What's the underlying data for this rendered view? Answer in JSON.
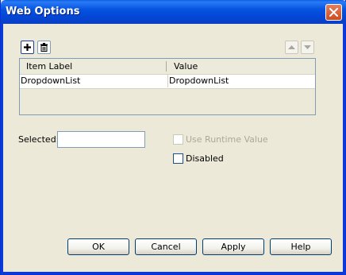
{
  "window": {
    "title": "Web Options"
  },
  "toolbar": {
    "add_icon": "plus-icon",
    "delete_icon": "trash-icon",
    "move_up_icon": "triangle-up-icon",
    "move_down_icon": "triangle-down-icon"
  },
  "grid": {
    "columns": [
      "Item Label",
      "Value"
    ],
    "rows": [
      {
        "label": "DropdownList",
        "value": "DropdownList"
      }
    ]
  },
  "selected": {
    "label": "Selected:",
    "value": ""
  },
  "use_runtime_value": {
    "label": "Use Runtime Value",
    "checked": false,
    "enabled": false
  },
  "disabled_option": {
    "label": "Disabled",
    "checked": false
  },
  "buttons": {
    "ok": "OK",
    "cancel": "Cancel",
    "apply": "Apply",
    "help": "Help"
  },
  "colors": {
    "titlebar": "#0553e0",
    "dialog_bg": "#ece9d8",
    "close_button": "#cf4a1e"
  }
}
